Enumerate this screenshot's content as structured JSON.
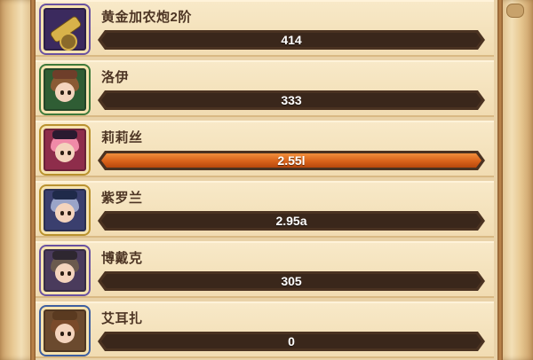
{
  "rows": [
    {
      "name": "黄金加农炮2阶",
      "value": "414",
      "fill": 0.0,
      "frame_color": "#6a52a0",
      "avatar_bg": "#3b2a5e",
      "icon": "golden-cannon-icon"
    },
    {
      "name": "洛伊",
      "value": "333",
      "fill": 0.0,
      "frame_color": "#3f7a3a",
      "avatar_bg": "#2f5d34",
      "icon": "loy-portrait"
    },
    {
      "name": "莉莉丝",
      "value": "2.55l",
      "fill": 1.0,
      "frame_color": "#b9922f",
      "avatar_bg": "#8e2d4b",
      "icon": "lilith-portrait"
    },
    {
      "name": "紫罗兰",
      "value": "2.95a",
      "fill": 0.0,
      "frame_color": "#b9922f",
      "avatar_bg": "#3a3f6e",
      "icon": "violet-portrait"
    },
    {
      "name": "博戴克",
      "value": "305",
      "fill": 0.0,
      "frame_color": "#6a52a0",
      "avatar_bg": "#4a3b5c",
      "icon": "bodeck-portrait"
    },
    {
      "name": "艾耳扎",
      "value": "0",
      "fill": 0.0,
      "frame_color": "#3f5fa0",
      "avatar_bg": "#6b4a2e",
      "icon": "elza-portrait"
    }
  ],
  "colors": {
    "bar_fill": "#d9631a",
    "bar_bg": "#3a271b",
    "panel_bg": "#f1dcb2",
    "name_text": "#4d3524"
  }
}
